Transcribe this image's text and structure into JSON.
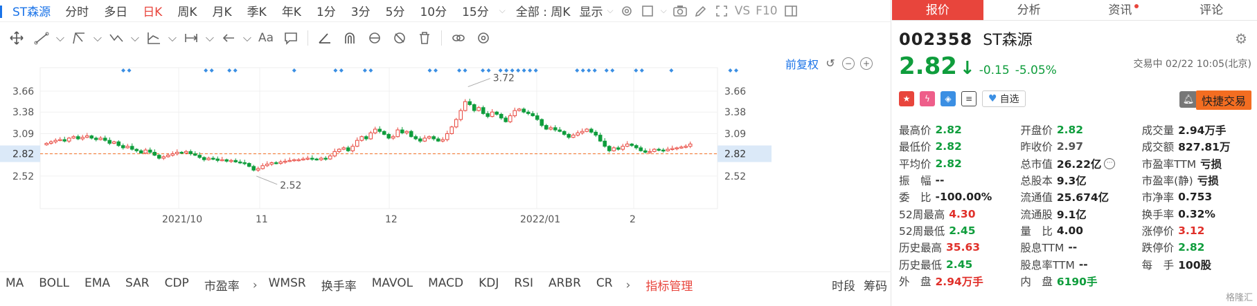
{
  "period_bar": {
    "code_name": "ST森源",
    "tabs": [
      "分时",
      "多日",
      "日K",
      "周K",
      "月K",
      "季K",
      "年K",
      "1分",
      "3分",
      "5分",
      "10分",
      "15分"
    ],
    "active_tab": "日K",
    "range_label": "全部 : 周K",
    "display_label": "显示",
    "vs_label": "VS",
    "f10_label": "F10"
  },
  "draw_bar": {
    "text_tool": "Aa"
  },
  "chart": {
    "restore_label": "前复权",
    "high_label": "3.72",
    "low_label": "2.52",
    "current_label": "2.82",
    "colors": {
      "up": "#e8453c",
      "down": "#0f9d3c",
      "current": "#f36d21",
      "marker": "#3b8fe3"
    }
  },
  "chart_data": {
    "type": "candlestick",
    "y_ticks": [
      3.66,
      3.38,
      3.09,
      2.82,
      2.52
    ],
    "x_ticks": [
      "2021/10",
      "11",
      "12",
      "2022/01",
      "2"
    ],
    "ylim": [
      2.38,
      3.92
    ],
    "current_price": 2.82,
    "annotations": [
      {
        "label": "3.72",
        "value": 3.72
      },
      {
        "label": "2.52",
        "value": 2.52
      }
    ],
    "closes": [
      2.96,
      2.98,
      3.0,
      3.01,
      2.99,
      3.03,
      3.05,
      3.02,
      3.04,
      3.06,
      3.03,
      3.01,
      3.03,
      3.0,
      2.96,
      2.98,
      2.93,
      2.9,
      2.92,
      2.88,
      2.86,
      2.83,
      2.87,
      2.84,
      2.8,
      2.76,
      2.78,
      2.8,
      2.82,
      2.84,
      2.83,
      2.85,
      2.82,
      2.8,
      2.77,
      2.74,
      2.76,
      2.75,
      2.73,
      2.74,
      2.72,
      2.73,
      2.71,
      2.7,
      2.69,
      2.65,
      2.6,
      2.62,
      2.66,
      2.68,
      2.7,
      2.69,
      2.71,
      2.72,
      2.73,
      2.74,
      2.74,
      2.75,
      2.76,
      2.75,
      2.74,
      2.76,
      2.75,
      2.79,
      2.85,
      2.88,
      2.9,
      2.86,
      2.92,
      3.0,
      3.05,
      3.02,
      3.1,
      3.15,
      3.12,
      3.08,
      3.03,
      3.05,
      3.14,
      3.1,
      3.12,
      3.05,
      3.02,
      2.99,
      3.03,
      3.05,
      3.02,
      2.99,
      3.01,
      3.09,
      3.18,
      3.28,
      3.4,
      3.52,
      3.48,
      3.4,
      3.44,
      3.36,
      3.32,
      3.38,
      3.35,
      3.3,
      3.25,
      3.33,
      3.4,
      3.42,
      3.38,
      3.36,
      3.33,
      3.28,
      3.2,
      3.15,
      3.17,
      3.14,
      3.12,
      3.08,
      3.04,
      3.07,
      3.1,
      3.12,
      3.15,
      3.11,
      3.07,
      2.99,
      2.92,
      2.86,
      2.9,
      2.88,
      2.92,
      2.95,
      2.93,
      2.9,
      2.86,
      2.84,
      2.85,
      2.88,
      2.87,
      2.86,
      2.88,
      2.89,
      2.9,
      2.91,
      2.92,
      2.95
    ]
  },
  "indicator_bar": {
    "items_a": [
      "MA",
      "BOLL",
      "EMA",
      "SAR",
      "CDP",
      "市盈率"
    ],
    "items_b": [
      "WMSR",
      "换手率",
      "MAVOL",
      "MACD",
      "KDJ",
      "RSI",
      "ARBR",
      "CR"
    ],
    "manage": "指标管理",
    "right": [
      "时段",
      "筹码"
    ]
  },
  "right_tabs": [
    "报价",
    "分析",
    "资讯",
    "评论"
  ],
  "quote": {
    "code": "002358",
    "name": "ST森源",
    "price": "2.82",
    "change": "-0.15",
    "change_pct": "-5.05%",
    "time": "交易中 02/22 10:05(北京)",
    "watch_label": "自选",
    "quick_trade": "快捷交易",
    "rows": [
      [
        {
          "l": "最高价",
          "v": "2.82",
          "c": "green"
        },
        {
          "l": "开盘价",
          "v": "2.82",
          "c": "green"
        },
        {
          "l": "成交量",
          "v": "2.94万手",
          "c": ""
        }
      ],
      [
        {
          "l": "最低价",
          "v": "2.82",
          "c": "green"
        },
        {
          "l": "昨收价",
          "v": "2.97",
          "c": "gray"
        },
        {
          "l": "成交额",
          "v": "827.81万",
          "c": ""
        }
      ],
      [
        {
          "l": "平均价",
          "v": "2.82",
          "c": "green"
        },
        {
          "l": "总市值",
          "v": "26.22亿",
          "c": "",
          "more": true
        },
        {
          "l": "市盈率TTM",
          "v": "亏损",
          "c": ""
        }
      ],
      [
        {
          "l": "振　幅",
          "v": "--",
          "c": ""
        },
        {
          "l": "总股本",
          "v": "9.3亿",
          "c": ""
        },
        {
          "l": "市盈率(静)",
          "v": "亏损",
          "c": ""
        }
      ],
      [
        {
          "l": "委　比",
          "v": "-100.00%",
          "c": ""
        },
        {
          "l": "流通值",
          "v": "25.674亿",
          "c": ""
        },
        {
          "l": "市净率",
          "v": "0.753",
          "c": ""
        }
      ],
      [
        {
          "l": "52周最高",
          "v": "4.30",
          "c": "red"
        },
        {
          "l": "流通股",
          "v": "9.1亿",
          "c": ""
        },
        {
          "l": "换手率",
          "v": "0.32%",
          "c": ""
        }
      ],
      [
        {
          "l": "52周最低",
          "v": "2.45",
          "c": "green"
        },
        {
          "l": "量　比",
          "v": "4.00",
          "c": ""
        },
        {
          "l": "涨停价",
          "v": "3.12",
          "c": "red"
        }
      ],
      [
        {
          "l": "历史最高",
          "v": "35.63",
          "c": "red"
        },
        {
          "l": "股息TTM",
          "v": "--",
          "c": ""
        },
        {
          "l": "跌停价",
          "v": "2.82",
          "c": "green"
        }
      ],
      [
        {
          "l": "历史最低",
          "v": "2.45",
          "c": "green"
        },
        {
          "l": "股息率TTM",
          "v": "--",
          "c": ""
        },
        {
          "l": "每　手",
          "v": "100股",
          "c": ""
        }
      ],
      [
        {
          "l": "外　盘",
          "v": "2.94万手",
          "c": "red"
        },
        {
          "l": "内　盘",
          "v": "6190手",
          "c": "green"
        },
        {
          "l": "",
          "v": "",
          "c": ""
        }
      ]
    ]
  },
  "watermark": "格隆汇"
}
